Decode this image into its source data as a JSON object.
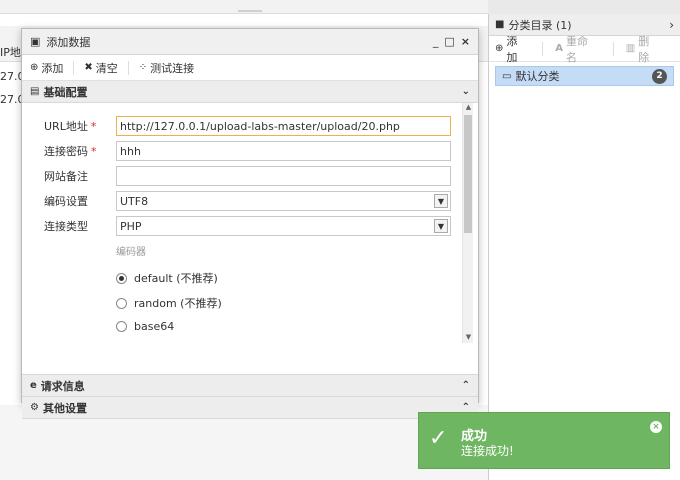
{
  "background": {
    "column_header": "IP地",
    "rows": [
      "27.0",
      "27.0"
    ]
  },
  "right_panel": {
    "title": "分类目录 (1)",
    "add_label": "添加",
    "rename_label": "重命名",
    "delete_label": "删除",
    "category": {
      "name": "默认分类",
      "count": "2"
    }
  },
  "dialog": {
    "title": "添加数据",
    "window_controls": {
      "minimize": "_",
      "maximize": "□",
      "close": "×"
    },
    "toolbar": {
      "add": "添加",
      "clear": "清空",
      "test": "测试连接"
    },
    "section_basic": "基础配置",
    "form": {
      "url_label": "URL地址",
      "url_value": "http://127.0.0.1/upload-labs-master/upload/20.php",
      "password_label": "连接密码",
      "password_value": "hhh",
      "note_label": "网站备注",
      "note_value": "",
      "encoding_label": "编码设置",
      "encoding_value": "UTF8",
      "type_label": "连接类型",
      "type_value": "PHP",
      "encoder_label": "编码器",
      "encoders": [
        {
          "label": "default (不推荐)",
          "selected": true
        },
        {
          "label": "random (不推荐)",
          "selected": false
        },
        {
          "label": "base64",
          "selected": false
        }
      ]
    },
    "section_request": "请求信息",
    "section_other": "其他设置"
  },
  "toast": {
    "title": "成功",
    "message": "连接成功!",
    "color": "#6fb662"
  }
}
